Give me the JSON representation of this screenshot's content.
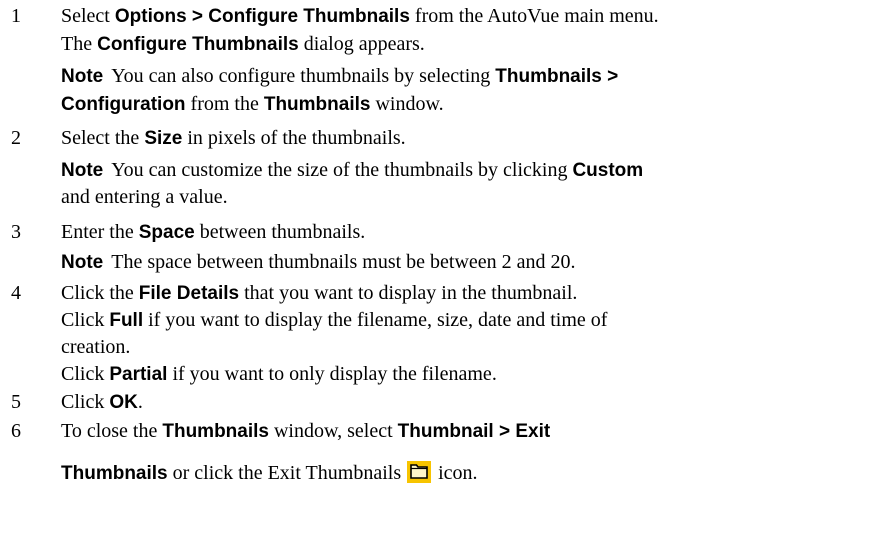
{
  "steps": [
    {
      "number": "1",
      "l1a": "Select ",
      "l1b": "Options > Configure Thumbnails",
      "l1c": " from the AutoVue main menu.",
      "l2a": "The ",
      "l2b": "Configure Thumbnails",
      "l2c": " dialog appears.",
      "note_label": "Note",
      "n1a": "You can also configure thumbnails by selecting ",
      "n1b": "Thumbnails >",
      "n2a": "Configuration",
      "n2b": " from the ",
      "n2c": "Thumbnails",
      "n2d": " window."
    },
    {
      "number": "2",
      "l1a": "Select the ",
      "l1b": "Size",
      "l1c": " in pixels of the thumbnails.",
      "note_label": "Note",
      "n1a": "You can customize the size of the thumbnails by clicking ",
      "n1b": "Custom",
      "n2a": "and entering a value."
    },
    {
      "number": "3",
      "l1a": "Enter the ",
      "l1b": "Space",
      "l1c": " between thumbnails.",
      "note_label": "Note",
      "n1a": "The space between thumbnails must be between 2 and 20."
    },
    {
      "number": "4",
      "l1a": "Click the ",
      "l1b": "File Details",
      "l1c": " that you want to display in the thumbnail.",
      "l2a": "Click ",
      "l2b": "Full",
      "l2c": " if you want to display the filename, size, date and time of",
      "l3a": "creation.",
      "l4a": "Click ",
      "l4b": "Partial",
      "l4c": " if you want to only display the filename."
    },
    {
      "number": "5",
      "l1a": "Click ",
      "l1b": "OK",
      "l1c": "."
    },
    {
      "number": "6",
      "l1a": "To close the ",
      "l1b": "Thumbnails",
      "l1c": " window, select ",
      "l1d": "Thumbnail > Exit",
      "l2a": "Thumbnails",
      "l2b": " or click the Exit Thumbnails",
      "l2c": "icon."
    }
  ],
  "icons": {
    "exit_thumbnails": "folder-icon"
  },
  "colors": {
    "icon_background": "#f7c400",
    "text": "#000000"
  }
}
